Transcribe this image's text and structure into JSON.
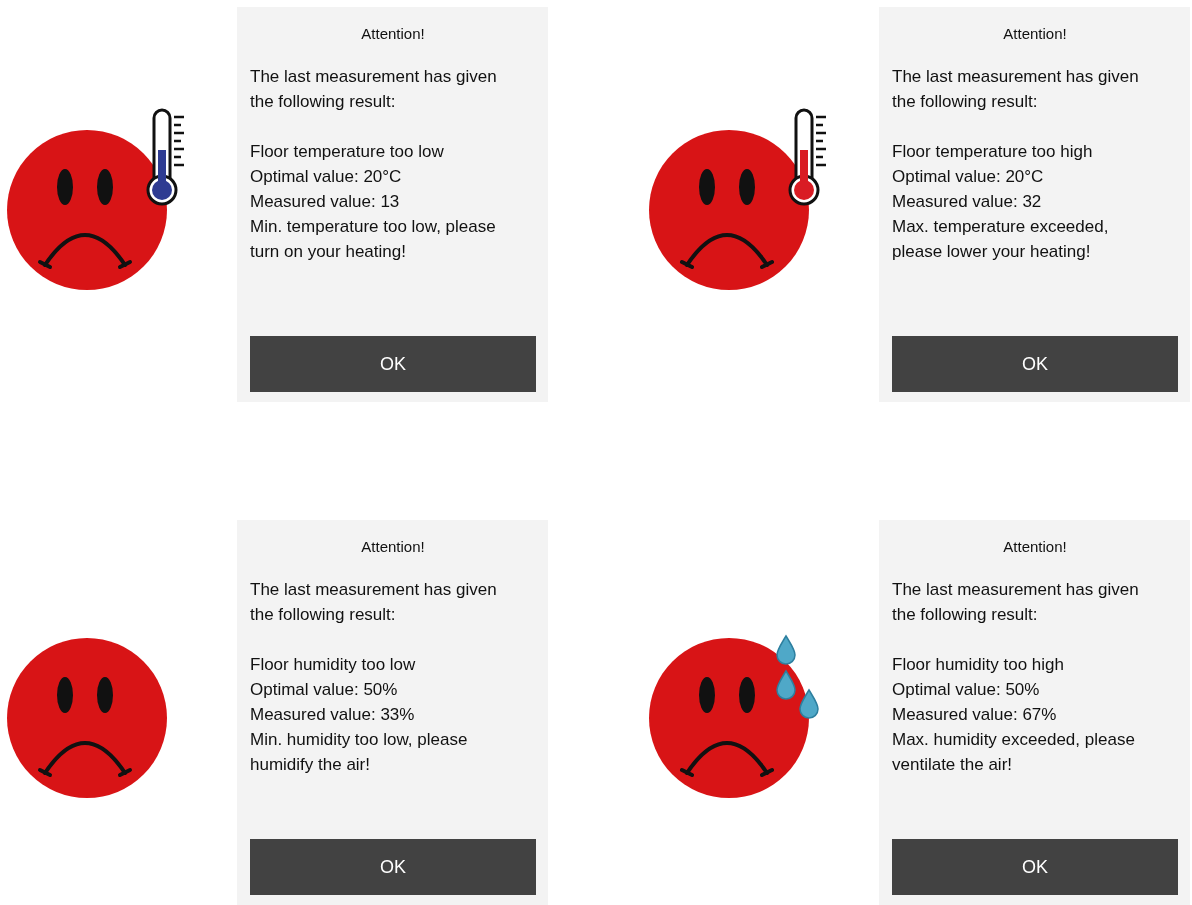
{
  "panels": [
    {
      "icon": {
        "kind": "thermometer",
        "color": "#2e3b92"
      },
      "dialog": {
        "title": "Attention!",
        "intro": "The last measurement has given\nthe following result:",
        "lines": [
          "Floor temperature too low",
          "Optimal value: 20°C",
          "Measured value: 13",
          "Min. temperature too low, please\nturn on your heating!"
        ],
        "button": "OK"
      }
    },
    {
      "icon": {
        "kind": "thermometer",
        "color": "#d91c24"
      },
      "dialog": {
        "title": "Attention!",
        "intro": "The last measurement has given\nthe following result:",
        "lines": [
          "Floor temperature too high",
          "Optimal value: 20°C",
          "Measured value: 32",
          "Max. temperature exceeded,\nplease lower your heating!"
        ],
        "button": "OK"
      }
    },
    {
      "icon": {
        "kind": "none"
      },
      "dialog": {
        "title": "Attention!",
        "intro": "The last measurement has given\nthe following result:",
        "lines": [
          "Floor humidity too low",
          "Optimal value: 50%",
          "Measured value: 33%",
          "Min. humidity too low, please\nhumidify the air!"
        ],
        "button": "OK"
      }
    },
    {
      "icon": {
        "kind": "droplets"
      },
      "dialog": {
        "title": "Attention!",
        "intro": "The last measurement has given\nthe following result:",
        "lines": [
          "Floor humidity too high",
          "Optimal value: 50%",
          "Measured value: 67%",
          "Max. humidity exceeded, please\nventilate the air!"
        ],
        "button": "OK"
      }
    }
  ]
}
